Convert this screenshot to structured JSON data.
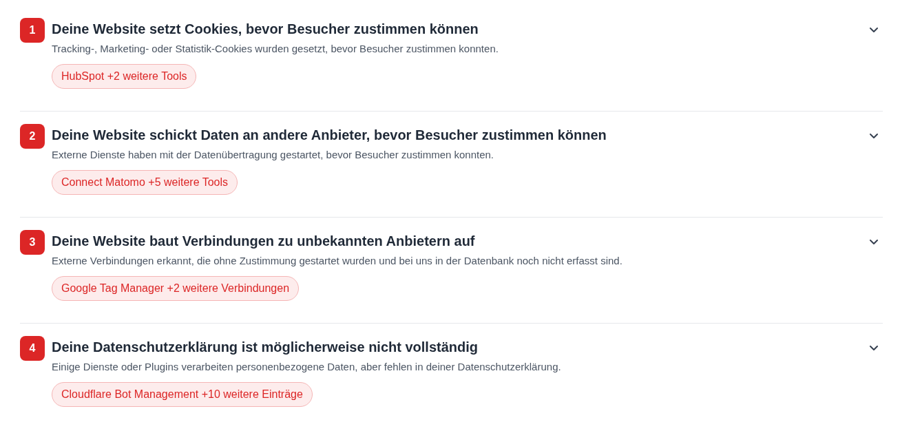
{
  "issues": [
    {
      "number": "1",
      "title": "Deine Website setzt Cookies, bevor Besucher zustimmen können",
      "description": "Tracking-, Marketing- oder Statistik-Cookies wurden gesetzt, bevor Besucher zustimmen konnten.",
      "tag": "HubSpot +2 weitere Tools"
    },
    {
      "number": "2",
      "title": "Deine Website schickt Daten an andere Anbieter, bevor Besucher zustimmen können",
      "description": "Externe Dienste haben mit der Datenübertragung gestartet, bevor Besucher zustimmen konnten.",
      "tag": "Connect Matomo +5 weitere Tools"
    },
    {
      "number": "3",
      "title": "Deine Website baut Verbindungen zu unbekannten Anbietern auf",
      "description": "Externe Verbindungen erkannt, die ohne Zustimmung gestartet wurden und bei uns in der Datenbank noch nicht erfasst sind.",
      "tag": "Google Tag Manager +2 weitere Verbindungen"
    },
    {
      "number": "4",
      "title": "Deine Datenschutzerklärung ist möglicherweise nicht vollständig",
      "description": "Einige Dienste oder Plugins verarbeiten personenbezogene Daten, aber fehlen in deiner Datenschutzerklärung.",
      "tag": "Cloudflare Bot Management +10 weitere Einträge"
    }
  ]
}
